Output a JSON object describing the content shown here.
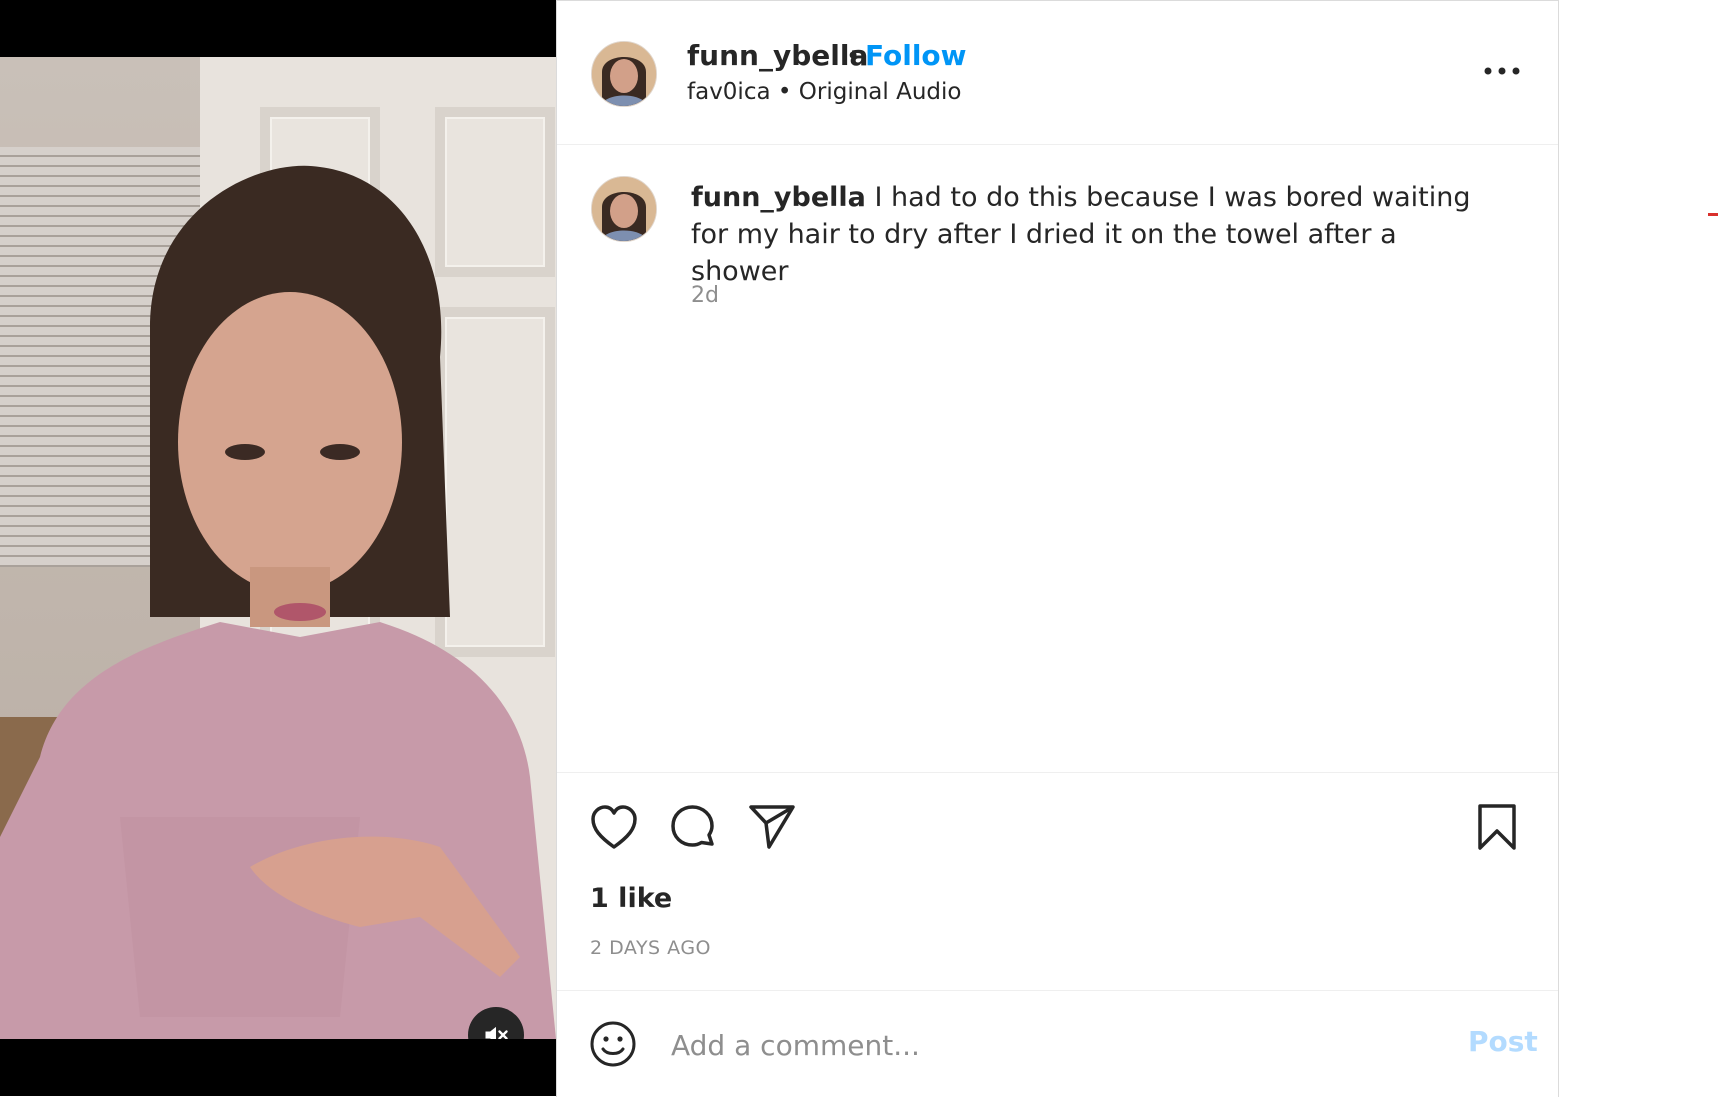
{
  "header": {
    "username": "funn_ybella",
    "separator": "•",
    "follow_label": "Follow",
    "audio_user": "fav0ica",
    "audio_separator": " • ",
    "audio_label": "Original Audio",
    "more_icon": "more-horizontal-icon"
  },
  "caption": {
    "username": "funn_ybella",
    "text": " I had to do this because I was bored waiting for my hair to dry after I dried it on the towel after a shower",
    "time": "2d"
  },
  "actions": {
    "icons": [
      "heart-icon",
      "comment-icon",
      "share-icon",
      "bookmark-icon"
    ],
    "likes": "1 like",
    "date": "2 DAYS AGO"
  },
  "comment": {
    "placeholder": "Add a comment...",
    "post_label": "Post",
    "emoji_icon": "smiley-icon"
  },
  "media": {
    "mute_icon": "muted-speaker-icon"
  },
  "colors": {
    "accent": "#0095f6",
    "post_disabled": "#b3dbff",
    "muted_text": "#8e8e8e",
    "text": "#262626"
  }
}
